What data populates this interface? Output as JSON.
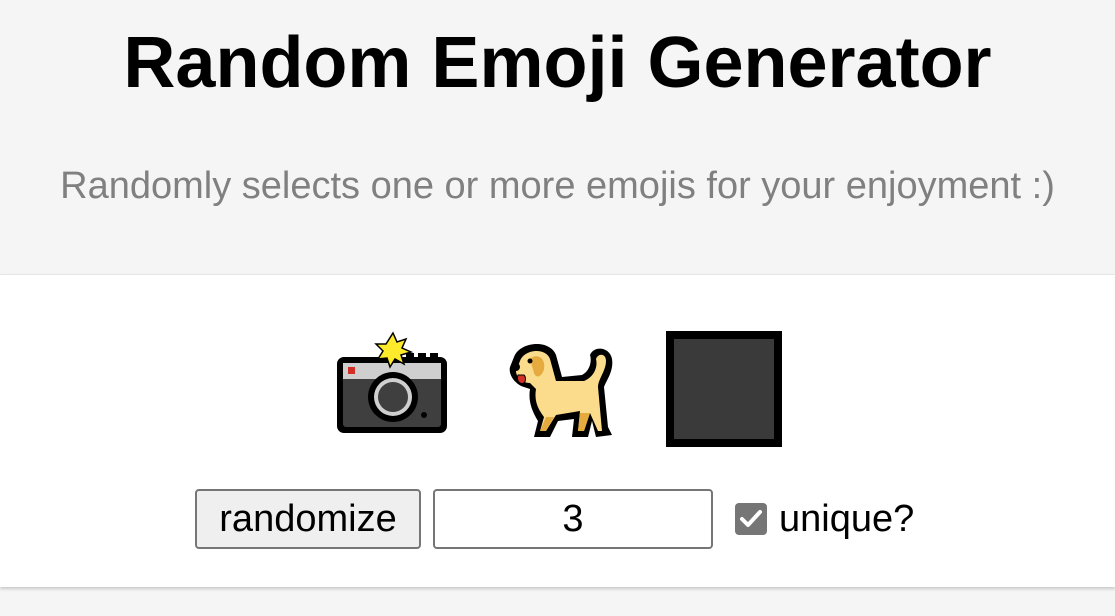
{
  "header": {
    "title": "Random Emoji Generator",
    "subtitle": "Randomly selects one or more emojis for your enjoyment :)"
  },
  "emojis": [
    {
      "name": "camera-with-flash",
      "icon": "camera-flash-icon"
    },
    {
      "name": "dog",
      "icon": "dog-icon"
    },
    {
      "name": "black-large-square",
      "icon": "black-square-icon"
    }
  ],
  "controls": {
    "randomize_label": "randomize",
    "count_value": "3",
    "unique_label": "unique?",
    "unique_checked": true
  },
  "colors": {
    "page_background": "#f5f5f5",
    "card_background": "#ffffff",
    "subtitle": "#808080",
    "checkbox": "#767676"
  }
}
